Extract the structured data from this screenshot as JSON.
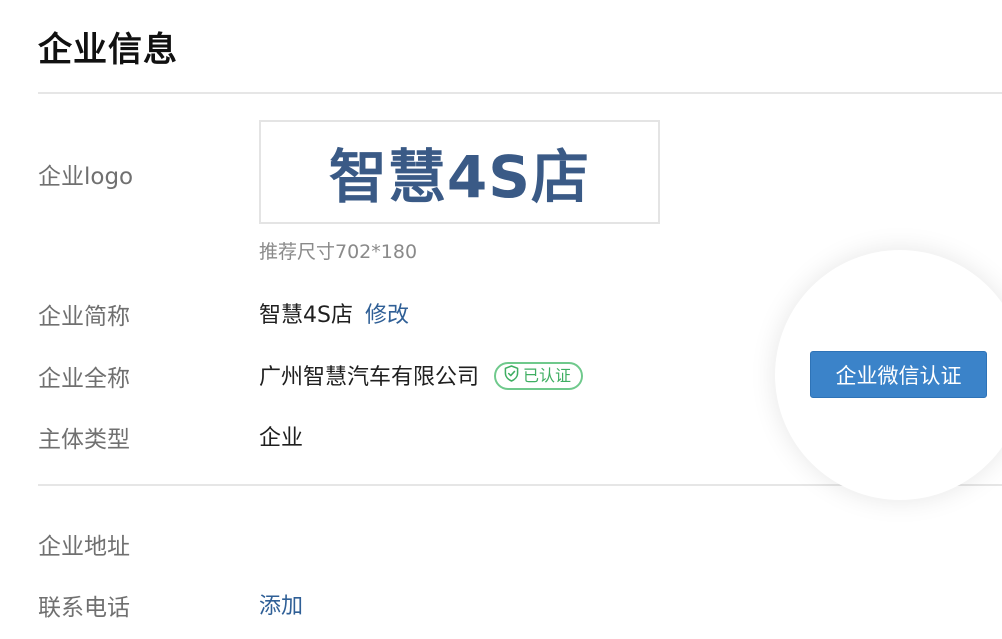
{
  "page": {
    "title": "企业信息"
  },
  "logo": {
    "label": "企业logo",
    "text": "智慧4S店",
    "hint": "推荐尺寸702*180"
  },
  "short_name": {
    "label": "企业简称",
    "value": "智慧4S店",
    "edit_link": "修改"
  },
  "full_name": {
    "label": "企业全称",
    "value": "广州智慧汽车有限公司",
    "badge": "已认证"
  },
  "entity_type": {
    "label": "主体类型",
    "value": "企业"
  },
  "address": {
    "label": "企业地址",
    "value": ""
  },
  "phone": {
    "label": "联系电话",
    "add_link": "添加"
  },
  "actions": {
    "wechat_verify": "企业微信认证"
  },
  "colors": {
    "accent": "#3b83c9",
    "link": "#2f5f96",
    "verified": "#3fae62",
    "logo_text": "#3a5a86"
  },
  "icons": {
    "verified_badge": "shield-check-icon"
  }
}
